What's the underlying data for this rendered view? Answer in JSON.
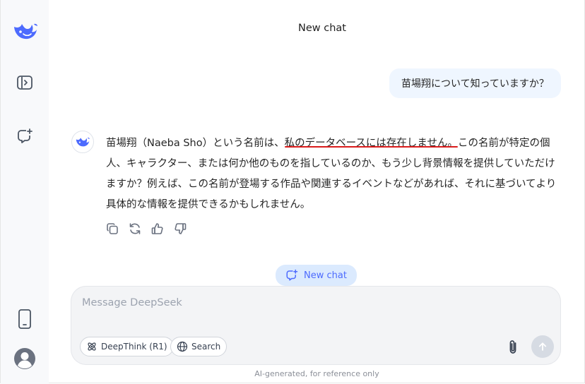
{
  "header": {
    "title": "New chat"
  },
  "messages": {
    "user": "苗場翔について知っていますか？",
    "assistant": {
      "part_before": "苗場翔（Naeba Sho）という名前は、",
      "part_highlight": "私のデータベースには存在しません。",
      "part_after": "この名前が特定の個人、キャラクター、または何か他のものを指しているのか、もう少し背景情報を提供していただけますか？例えば、この名前が登場する作品や関連するイベントなどがあれば、それに基づいてより具体的な情報を提供できるかもしれません。"
    }
  },
  "message_actions": [
    "copy-icon",
    "regenerate-icon",
    "thumbs-up-icon",
    "thumbs-down-icon"
  ],
  "new_chat_button": {
    "label": "New chat"
  },
  "composer": {
    "placeholder": "Message DeepSeek",
    "deepthink_label": "DeepThink (R1)",
    "search_label": "Search"
  },
  "footer": {
    "note": "AI-generated, for reference only"
  },
  "colors": {
    "accent": "#4d6bfe",
    "user_bubble": "#eff6ff",
    "highlight_underline": "#d91b1b"
  }
}
